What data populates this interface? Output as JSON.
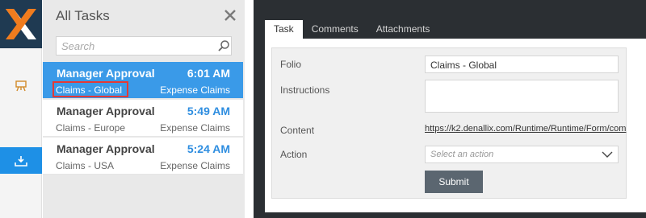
{
  "task_list": {
    "title": "All Tasks",
    "search": {
      "placeholder": "Search",
      "value": ""
    },
    "tasks": [
      {
        "title": "Manager Approval",
        "time": "6:01 AM",
        "folio": "Claims - Global",
        "process": "Expense Claims",
        "selected": true
      },
      {
        "title": "Manager Approval",
        "time": "5:49 AM",
        "folio": "Claims - Europe",
        "process": "Expense Claims",
        "selected": false
      },
      {
        "title": "Manager Approval",
        "time": "5:24 AM",
        "folio": "Claims - USA",
        "process": "Expense Claims",
        "selected": false
      }
    ]
  },
  "detail": {
    "tabs": [
      {
        "label": "Task",
        "active": true
      },
      {
        "label": "Comments",
        "active": false
      },
      {
        "label": "Attachments",
        "active": false
      }
    ],
    "form": {
      "folio_label": "Folio",
      "folio_value": "Claims - Global",
      "instructions_label": "Instructions",
      "instructions_value": "",
      "content_label": "Content",
      "content_link": "https://k2.denallix.com/Runtime/Runtime/Form/com",
      "action_label": "Action",
      "action_placeholder": "Select an action",
      "submit_label": "Submit"
    }
  },
  "colors": {
    "accent": "#1e90e6",
    "selected_row": "#3a9ae8",
    "time_text": "#2f8ee0",
    "highlight_box": "#e53935",
    "logo_bg": "#1f3a52",
    "logo_orange": "#f07c1e",
    "dark_bg": "#2b2f33",
    "submit_bg": "#5b6670"
  },
  "icons": {
    "logo": "k2-x-logo",
    "rail_item": "easel-icon",
    "rail_active": "download-tray-icon",
    "close": "close-icon",
    "search": "search-icon",
    "dropdown": "chevron-down-icon"
  }
}
